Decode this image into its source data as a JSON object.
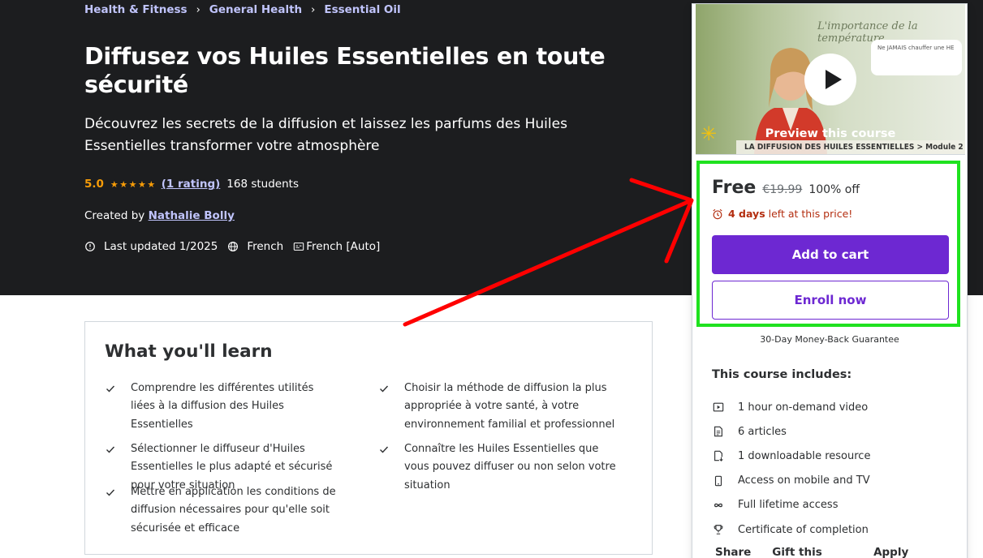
{
  "breadcrumb": [
    "Health & Fitness",
    "General Health",
    "Essential Oil"
  ],
  "course": {
    "title": "Diffusez vos Huiles Essentielles en toute sécurité",
    "subtitle": "Découvrez les secrets de la diffusion et laissez les parfums des Huiles Essentielles transformer votre atmosphère",
    "rating": "5.0",
    "stars": 5,
    "rating_count": "(1 rating)",
    "students": "168 students",
    "created_by_label": "Created by",
    "instructor": "Nathalie Bolly",
    "last_updated": "Last updated 1/2025",
    "language": "French",
    "captions": "French [Auto]"
  },
  "preview": {
    "label": "Preview this course",
    "slide_title": "L'importance de la température",
    "slide_note": "Ne JAMAIS chauffer une HE",
    "lower_third": "LA DIFFUSION DES HUILES ESSENTIELLES > Module 2"
  },
  "purchase": {
    "price": "Free",
    "original_price": "€19.99",
    "discount": "100% off",
    "timer_days": "4 days",
    "timer_text": "left at this price!",
    "add_to_cart": "Add to cart",
    "enroll_now": "Enroll now",
    "guarantee": "30-Day Money-Back Guarantee"
  },
  "includes": {
    "title": "This course includes:",
    "items": [
      {
        "icon": "video-icon",
        "label": "1 hour on-demand video"
      },
      {
        "icon": "article-icon",
        "label": "6 articles"
      },
      {
        "icon": "download-file-icon",
        "label": "1 downloadable resource"
      },
      {
        "icon": "mobile-icon",
        "label": "Access on mobile and TV"
      },
      {
        "icon": "infinity-icon",
        "label": "Full lifetime access"
      },
      {
        "icon": "trophy-icon",
        "label": "Certificate of completion"
      }
    ]
  },
  "card_links": [
    "Share",
    "Gift this course",
    "Apply Coupon"
  ],
  "learn": {
    "title": "What you'll learn",
    "items": [
      "Comprendre les différentes utilités liées à la diffusion des Huiles Essentielles",
      "Choisir la méthode de diffusion la plus appropriée à votre santé, à votre environnement familial et professionnel",
      "Sélectionner le diffuseur d'Huiles Essentielles le plus adapté et sécurisé pour votre situation",
      "Connaître les Huiles Essentielles que vous pouvez diffuser ou non selon votre situation",
      "Mettre en application les conditions de diffusion nécessaires pour qu'elle soit sécurisée et efficace"
    ]
  },
  "colors": {
    "hero_bg": "#1c1d1f",
    "link": "#c0c4fc",
    "star": "#f69c08",
    "primary": "#6d28d2",
    "timer": "#b32d0f",
    "annotation_box": "#1fe21f",
    "annotation_arrow": "#ff0000"
  }
}
